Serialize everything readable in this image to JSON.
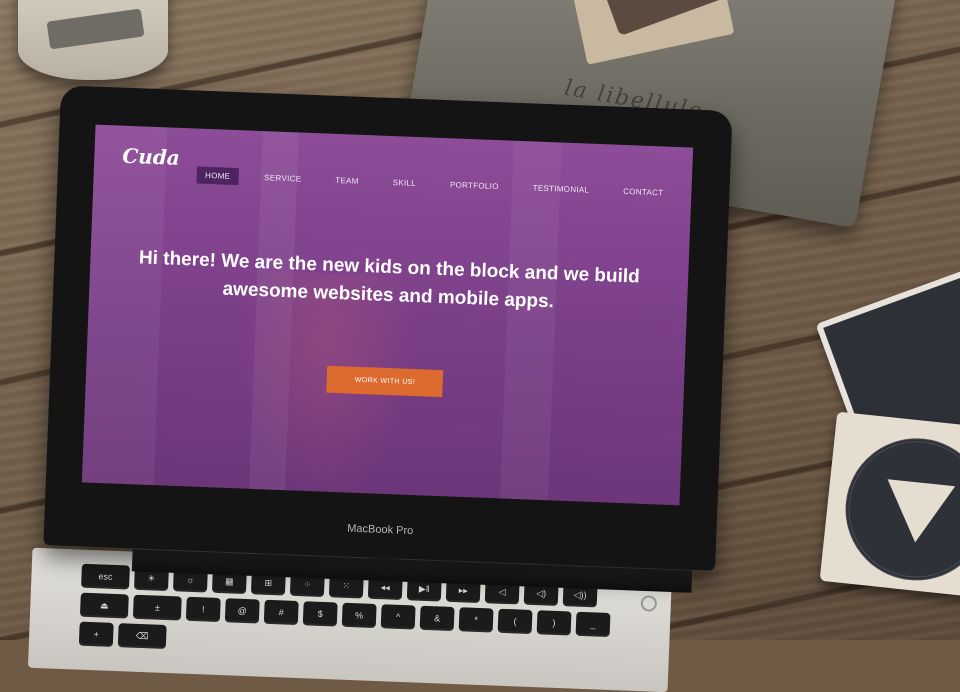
{
  "brand": {
    "logo_text": "Cuda"
  },
  "nav": {
    "items": [
      {
        "label": "HOME",
        "active": true
      },
      {
        "label": "SERVICE",
        "active": false
      },
      {
        "label": "TEAM",
        "active": false
      },
      {
        "label": "SKILL",
        "active": false
      },
      {
        "label": "PORTFOLIO",
        "active": false
      },
      {
        "label": "TESTIMONIAL",
        "active": false
      },
      {
        "label": "CONTACT",
        "active": false
      }
    ]
  },
  "hero": {
    "headline_line1": "Hi there! We are the new kids on the block and we build",
    "headline_line2": "awesome websites and mobile apps.",
    "cta_label": "WORK WITH US!"
  },
  "laptop": {
    "model_label": "MacBook Pro"
  },
  "pouch": {
    "text": "la libellule"
  },
  "keyboard": {
    "row1": [
      "esc",
      "☀",
      "☼",
      "▦",
      "⊞",
      "⁘",
      "⁙",
      "◂◂",
      "▶‖",
      "▸▸",
      "◁",
      "◁)",
      "◁))",
      "⏏"
    ],
    "row2": [
      "±",
      "!",
      "@",
      "#",
      "$",
      "%",
      "^",
      "&",
      "*",
      "(",
      ")",
      "_",
      "+",
      "⌫"
    ]
  },
  "colors": {
    "screen_purple": "#7b3f88",
    "nav_active_bg": "#4d2460",
    "cta_orange": "#dd6a2e"
  }
}
